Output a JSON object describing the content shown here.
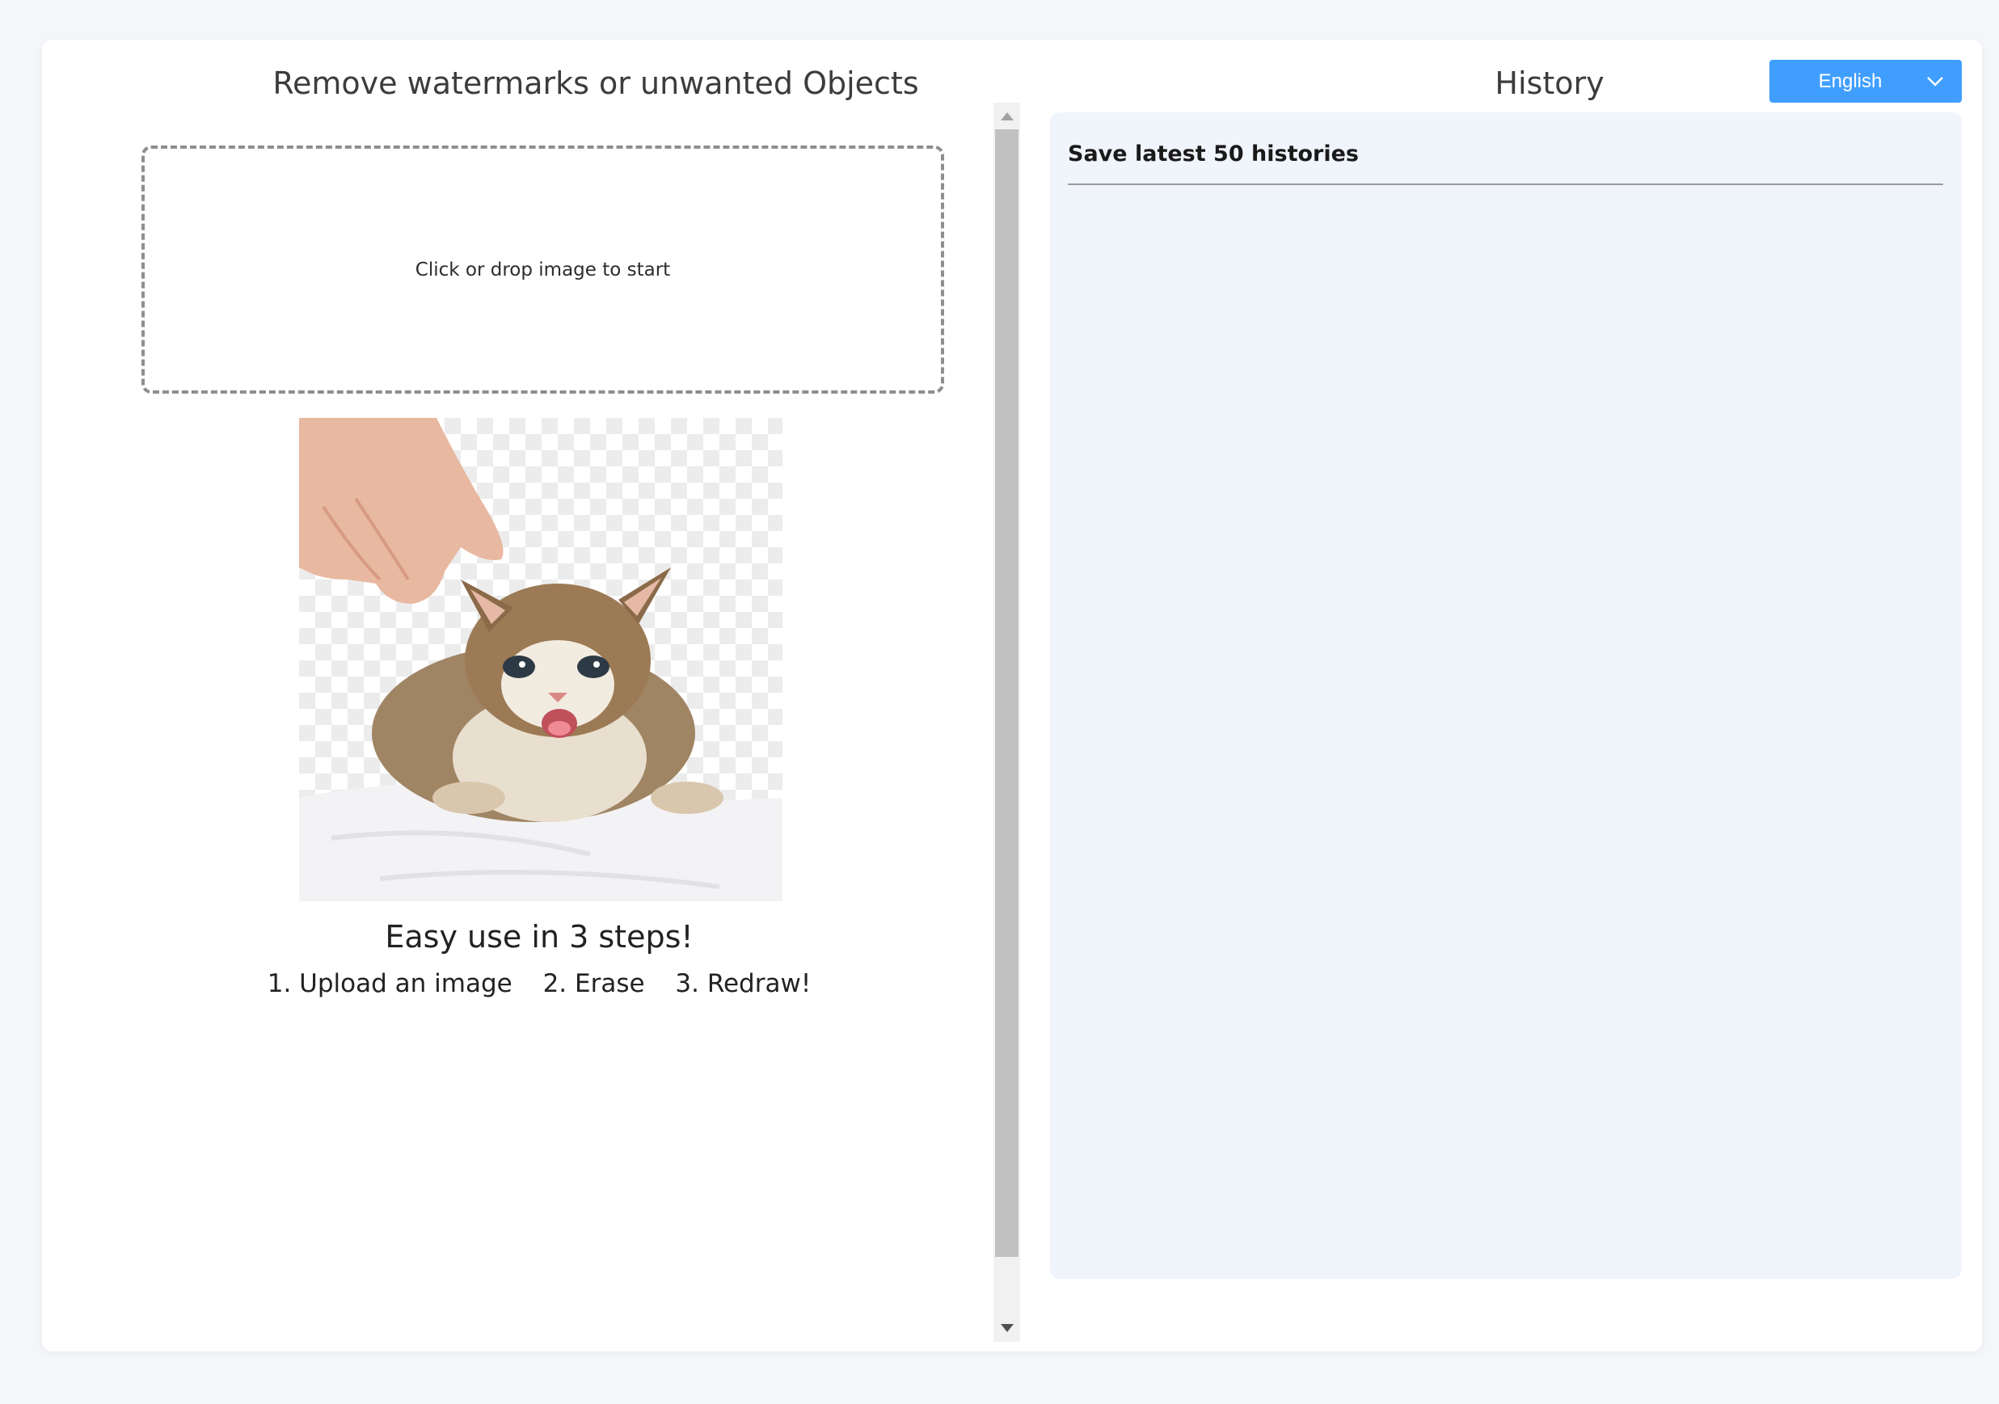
{
  "left_panel": {
    "title": "Remove watermarks or unwanted Objects",
    "dropzone_text": "Click or drop image to start",
    "demo_image_icon": "kitten-demo-image",
    "steps_title": "Easy use in 3 steps!",
    "steps": [
      "1. Upload an image",
      "2. Erase",
      "3. Redraw!"
    ]
  },
  "right_panel": {
    "title": "History",
    "history_header": "Save latest 50 histories",
    "language_select": {
      "selected": "English",
      "icon": "chevron-down-icon"
    }
  },
  "colors": {
    "accent": "#409eff",
    "history_bg": "#f0f4fb",
    "page_bg": "#f4f6f9"
  }
}
